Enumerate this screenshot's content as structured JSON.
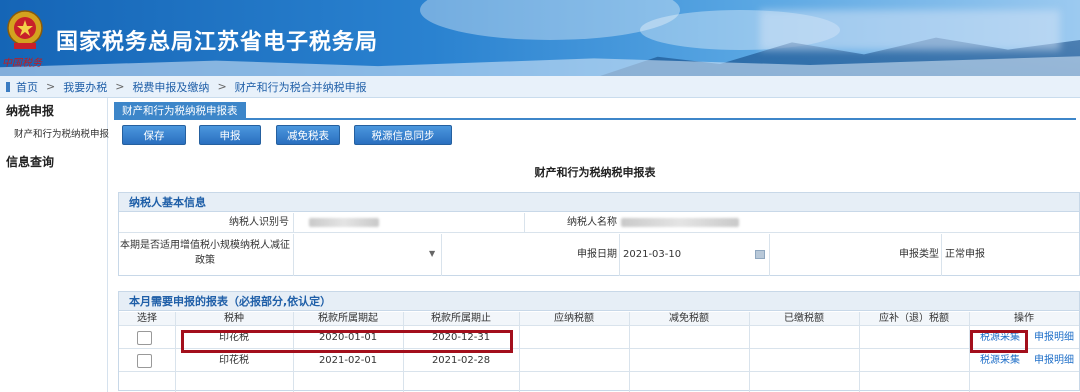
{
  "header": {
    "title": "国家税务总局江苏省电子税务局",
    "signature": "中国税务"
  },
  "breadcrumb": [
    "首页",
    "我要办税",
    "税费申报及缴纳",
    "财产和行为税合并纳税申报"
  ],
  "sidebar": {
    "sections": [
      {
        "title": "纳税申报",
        "items": [
          "财产和行为税纳税申报"
        ]
      },
      {
        "title": "信息查询",
        "items": []
      }
    ]
  },
  "tab": {
    "label": "财产和行为税纳税申报表"
  },
  "toolbar": {
    "save": "保存",
    "declare": "申报",
    "reduce": "减免税表",
    "sync": "税源信息同步"
  },
  "form_title": "财产和行为税纳税申报表",
  "basic_info": {
    "heading": "纳税人基本信息",
    "taxpayer_id_label": "纳税人识别号",
    "taxpayer_name_label": "纳税人名称",
    "policy_label_line1": "本期是否适用增值税小规模纳税人减征",
    "policy_label_line2": "政策",
    "declare_date_label": "申报日期",
    "declare_date_value": "2021-03-10",
    "declare_type_label": "申报类型",
    "declare_type_value": "正常申报"
  },
  "report": {
    "heading": "本月需要申报的报表（必报部分,依认定）",
    "columns": [
      "选择",
      "税种",
      "税款所属期起",
      "税款所属期止",
      "应纳税额",
      "减免税额",
      "已缴税额",
      "应补（退）税额",
      "操作"
    ],
    "rows": [
      {
        "tax": "印花税",
        "from": "2020-01-01",
        "to": "2020-12-31",
        "op1": "税源采集",
        "op2": "申报明细"
      },
      {
        "tax": "印花税",
        "from": "2021-02-01",
        "to": "2021-02-28",
        "op1": "税源采集",
        "op2": "申报明细"
      }
    ]
  },
  "colors": {
    "header_blue": "#1565b6",
    "highlight_red": "#a30f1c",
    "link_blue": "#1f6fc8"
  }
}
